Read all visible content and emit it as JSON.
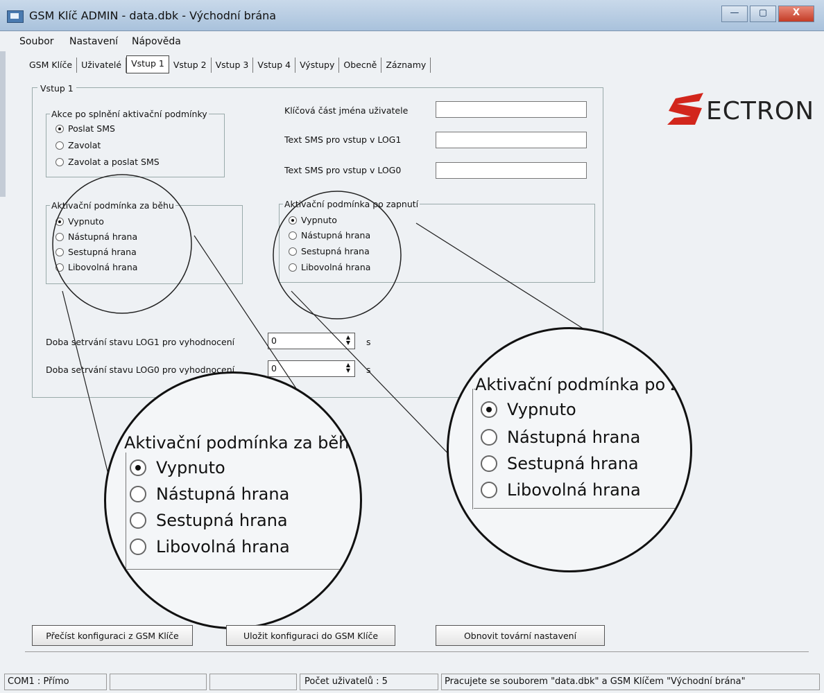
{
  "window": {
    "title": "GSM Klíč ADMIN - data.dbk - Východní brána",
    "buttons": {
      "minimize": "—",
      "maximize": "▢",
      "close": "X"
    }
  },
  "menu": [
    "Soubor",
    "Nastavení",
    "Nápověda"
  ],
  "tabs": [
    "GSM Klíče",
    "Uživatelé",
    "Vstup 1",
    "Vstup 2",
    "Vstup 3",
    "Vstup 4",
    "Výstupy",
    "Obecně",
    "Záznamy"
  ],
  "active_tab": "Vstup 1",
  "panel": {
    "title": "Vstup 1",
    "action_group": {
      "title": "Akce po splnění aktivační podmínky",
      "options": [
        "Poslat SMS",
        "Zavolat",
        "Zavolat a poslat SMS"
      ],
      "selected": "Poslat SMS"
    },
    "fields": [
      {
        "label": "Klíčová část  jména uživatele",
        "value": ""
      },
      {
        "label": "Text SMS pro vstup v LOG1",
        "value": ""
      },
      {
        "label": "Text SMS pro vstup v LOG0",
        "value": ""
      }
    ],
    "runtime_group": {
      "title": "Aktivační podmínka za běhu",
      "options": [
        "Vypnuto",
        "Nástupná hrana",
        "Sestupná hrana",
        "Libovolná hrana"
      ],
      "selected": "Vypnuto"
    },
    "startup_group": {
      "title": "Aktivační podmínka po zapnutí",
      "options": [
        "Vypnuto",
        "Nástupná hrana",
        "Sestupná hrana",
        "Libovolná hrana"
      ],
      "selected": "Vypnuto"
    },
    "duration_log1": {
      "label": "Doba setrvání stavu LOG1 pro vyhodnocení",
      "value": "0",
      "unit": "s"
    },
    "duration_log0": {
      "label": "Doba setrvání stavu LOG0 pro vyhodnocení",
      "value": "0",
      "unit": "s"
    }
  },
  "zoom_left": {
    "title": "Aktivační podmínka za běhu",
    "options": [
      "Vypnuto",
      "Nástupná hrana",
      "Sestupná hrana",
      "Libovolná hrana"
    ]
  },
  "zoom_right": {
    "title": "Aktivační podmínka po za",
    "options": [
      "Vypnuto",
      "Nástupná hrana",
      "Sestupná hrana",
      "Libovolná hrana"
    ]
  },
  "logo": {
    "text": "ECTRON",
    "accent": "#d2261c"
  },
  "buttons": {
    "read": "Přečíst konfiguraci z GSM Klíče",
    "save": "Uložit konfiguraci do GSM Klíče",
    "reset": "Obnovit tovární nastavení"
  },
  "status": {
    "port": "COM1 : Přímo",
    "users": "Počet uživatelů : 5",
    "message": "Pracujete se souborem \"data.dbk\" a GSM Klíčem \"Východní brána\""
  }
}
